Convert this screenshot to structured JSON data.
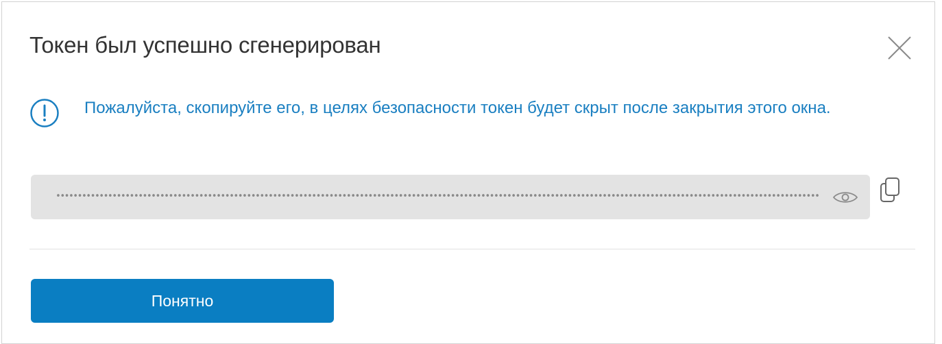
{
  "dialog": {
    "title": "Токен был успешно сгенерирован",
    "close_icon": "close-icon"
  },
  "alert": {
    "icon": "warning-circle-icon",
    "message": "Пожалуйста, скопируйте его, в целях безопасности токен будет скрыт после закрытия этого окна.",
    "color": "#1a7fc1"
  },
  "token": {
    "masked_value": "••••••••••••••••••••••••••••••••••••••••••••••••••••••••••••••••••••••••••••••••••••••••••••••••••••••••••••••••••••••••••••••••••••••••••••••••••••••••••••••••••••••••••••••••••••••••••••",
    "visibility_icon": "eye-icon",
    "copy_icon": "copy-icon"
  },
  "footer": {
    "confirm_label": "Понятно",
    "accent": "#0a7ec2"
  }
}
